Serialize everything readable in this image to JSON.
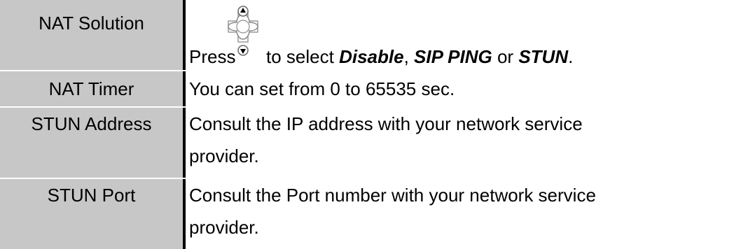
{
  "rows": [
    {
      "label": "NAT Solution",
      "desc": {
        "press": "Press",
        "to_select": "to select ",
        "opt1": "Disable",
        "comma": ", ",
        "opt2": "SIP PING",
        "or": " or ",
        "opt3": "STUN",
        "period": "."
      },
      "icon": "navigation-key-icon"
    },
    {
      "label": "NAT Timer",
      "desc": "You can set from 0 to 65535 sec."
    },
    {
      "label": "STUN Address",
      "desc_line1": "Consult the IP address with your network service",
      "desc_line2": "provider."
    },
    {
      "label": "STUN Port",
      "desc_line1": "Consult the Port number with your network service",
      "desc_line2": "provider."
    }
  ],
  "colors": {
    "label_bg": "#c7c7c7",
    "divider": "#000000",
    "text": "#000000",
    "background": "#ffffff"
  }
}
